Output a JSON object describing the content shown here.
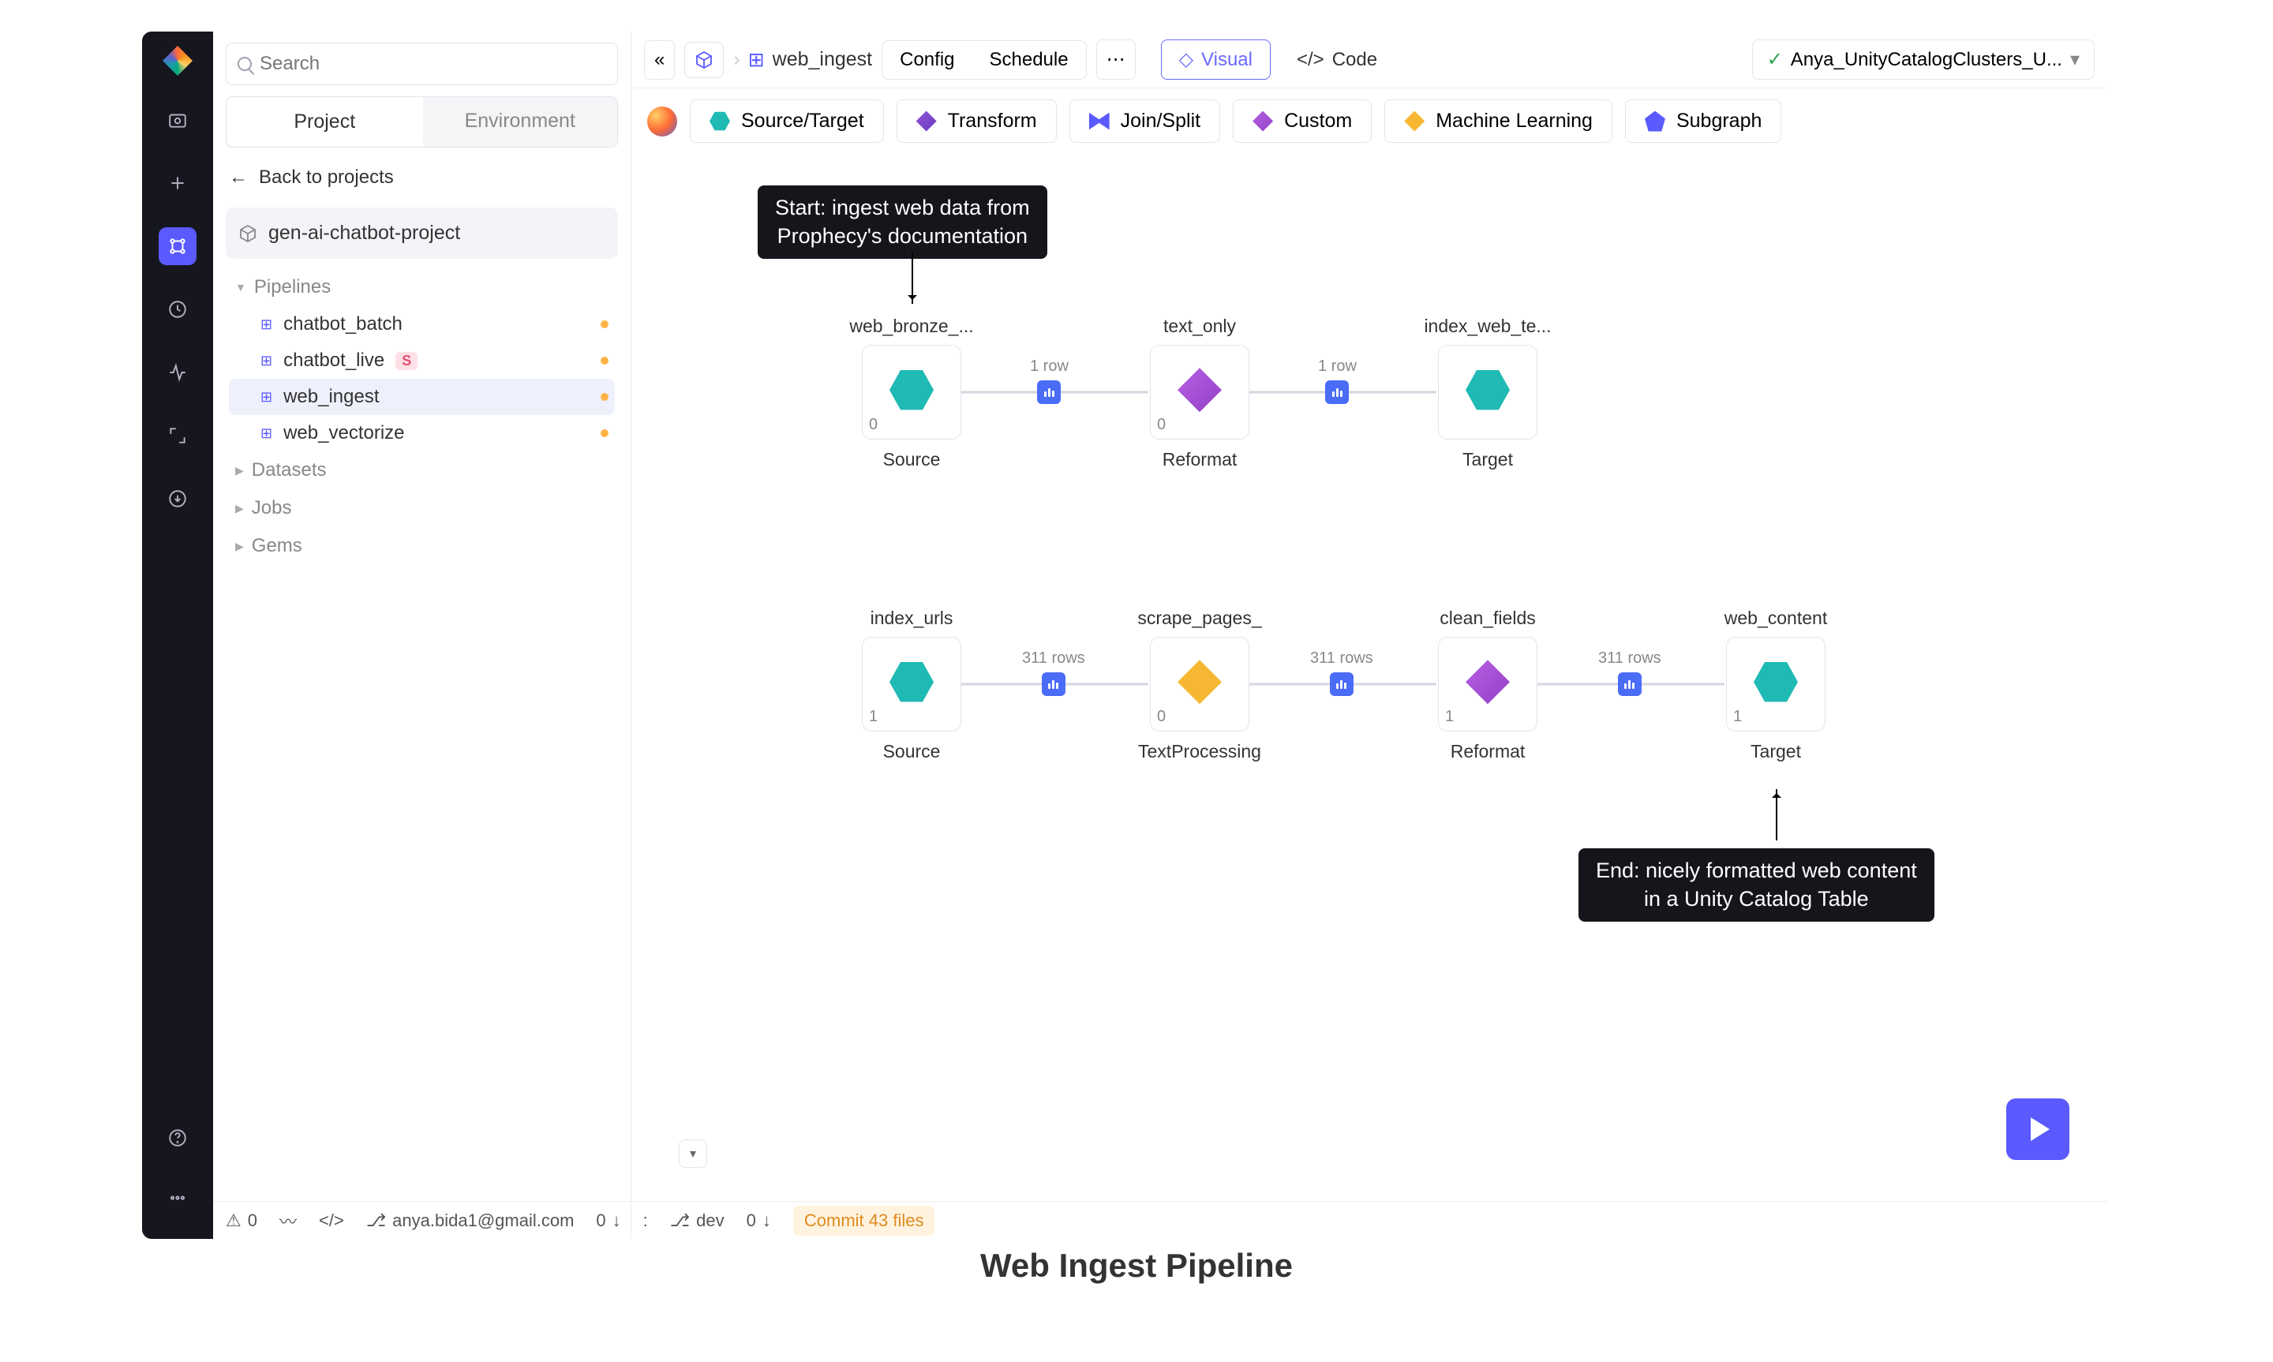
{
  "caption": "Web Ingest Pipeline",
  "search": {
    "placeholder": "Search"
  },
  "sidebarTabs": {
    "project": "Project",
    "environment": "Environment"
  },
  "backLabel": "Back to projects",
  "projectName": "gen-ai-chatbot-project",
  "tree": {
    "pipelinesLabel": "Pipelines",
    "pipelines": [
      "chatbot_batch",
      "chatbot_live",
      "web_ingest",
      "web_vectorize"
    ],
    "datasetsLabel": "Datasets",
    "jobsLabel": "Jobs",
    "gemsLabel": "Gems"
  },
  "topbar": {
    "pipelineName": "web_ingest",
    "configLabel": "Config",
    "scheduleLabel": "Schedule",
    "visualLabel": "Visual",
    "codeLabel": "Code",
    "clusterName": "Anya_UnityCatalogClusters_U..."
  },
  "palette": {
    "sourceTarget": "Source/Target",
    "transform": "Transform",
    "joinSplit": "Join/Split",
    "custom": "Custom",
    "ml": "Machine Learning",
    "subgraph": "Subgraph"
  },
  "nodes": {
    "r1n1": {
      "top": "web_bronze_...",
      "count": "0",
      "sub": "Source"
    },
    "r1n2": {
      "top": "text_only",
      "count": "0",
      "sub": "Reformat"
    },
    "r1n3": {
      "top": "index_web_te...",
      "count": "",
      "sub": "Target"
    },
    "r2n1": {
      "top": "index_urls",
      "count": "1",
      "sub": "Source"
    },
    "r2n2": {
      "top": "scrape_pages_",
      "count": "0",
      "sub": "TextProcessing"
    },
    "r2n3": {
      "top": "clean_fields",
      "count": "1",
      "sub": "Reformat"
    },
    "r2n4": {
      "top": "web_content",
      "count": "1",
      "sub": "Target"
    }
  },
  "edges": {
    "one": "1 row",
    "many": "311 rows"
  },
  "annot": {
    "start": "Start: ingest web data from\nProphecy's documentation",
    "end": "End: nicely formatted web content\nin a Unity Catalog Table"
  },
  "status": {
    "warnCount": "0",
    "email": "anya.bida1@gmail.com",
    "left0": "0",
    "branch": "dev",
    "right0": "0",
    "commit": "Commit 43 files",
    "colon": ":"
  }
}
